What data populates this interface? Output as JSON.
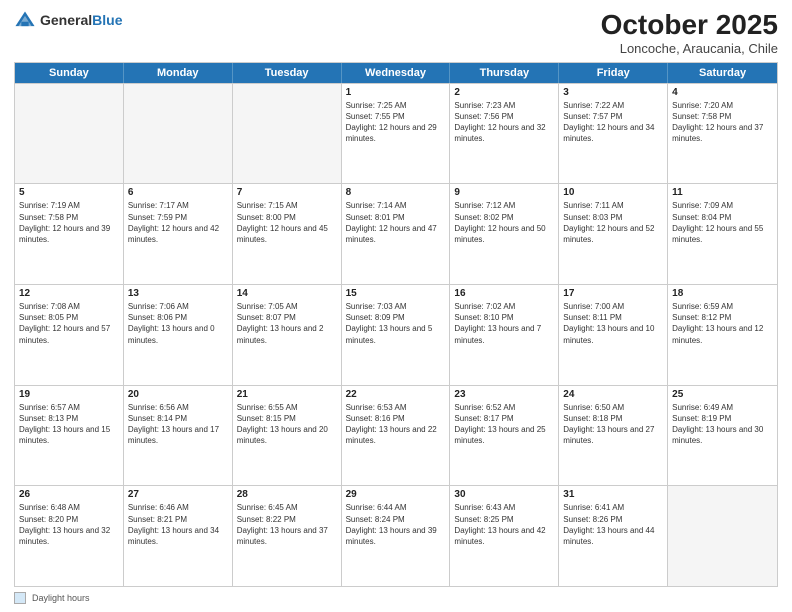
{
  "header": {
    "logo_general": "General",
    "logo_blue": "Blue",
    "month_title": "October 2025",
    "location": "Loncoche, Araucania, Chile"
  },
  "days_of_week": [
    "Sunday",
    "Monday",
    "Tuesday",
    "Wednesday",
    "Thursday",
    "Friday",
    "Saturday"
  ],
  "footer": {
    "label": "Daylight hours"
  },
  "weeks": [
    [
      {
        "day": "",
        "sunrise": "",
        "sunset": "",
        "daylight": "",
        "empty": true
      },
      {
        "day": "",
        "sunrise": "",
        "sunset": "",
        "daylight": "",
        "empty": true
      },
      {
        "day": "",
        "sunrise": "",
        "sunset": "",
        "daylight": "",
        "empty": true
      },
      {
        "day": "1",
        "sunrise": "Sunrise: 7:25 AM",
        "sunset": "Sunset: 7:55 PM",
        "daylight": "Daylight: 12 hours and 29 minutes."
      },
      {
        "day": "2",
        "sunrise": "Sunrise: 7:23 AM",
        "sunset": "Sunset: 7:56 PM",
        "daylight": "Daylight: 12 hours and 32 minutes."
      },
      {
        "day": "3",
        "sunrise": "Sunrise: 7:22 AM",
        "sunset": "Sunset: 7:57 PM",
        "daylight": "Daylight: 12 hours and 34 minutes."
      },
      {
        "day": "4",
        "sunrise": "Sunrise: 7:20 AM",
        "sunset": "Sunset: 7:58 PM",
        "daylight": "Daylight: 12 hours and 37 minutes."
      }
    ],
    [
      {
        "day": "5",
        "sunrise": "Sunrise: 7:19 AM",
        "sunset": "Sunset: 7:58 PM",
        "daylight": "Daylight: 12 hours and 39 minutes."
      },
      {
        "day": "6",
        "sunrise": "Sunrise: 7:17 AM",
        "sunset": "Sunset: 7:59 PM",
        "daylight": "Daylight: 12 hours and 42 minutes."
      },
      {
        "day": "7",
        "sunrise": "Sunrise: 7:15 AM",
        "sunset": "Sunset: 8:00 PM",
        "daylight": "Daylight: 12 hours and 45 minutes."
      },
      {
        "day": "8",
        "sunrise": "Sunrise: 7:14 AM",
        "sunset": "Sunset: 8:01 PM",
        "daylight": "Daylight: 12 hours and 47 minutes."
      },
      {
        "day": "9",
        "sunrise": "Sunrise: 7:12 AM",
        "sunset": "Sunset: 8:02 PM",
        "daylight": "Daylight: 12 hours and 50 minutes."
      },
      {
        "day": "10",
        "sunrise": "Sunrise: 7:11 AM",
        "sunset": "Sunset: 8:03 PM",
        "daylight": "Daylight: 12 hours and 52 minutes."
      },
      {
        "day": "11",
        "sunrise": "Sunrise: 7:09 AM",
        "sunset": "Sunset: 8:04 PM",
        "daylight": "Daylight: 12 hours and 55 minutes."
      }
    ],
    [
      {
        "day": "12",
        "sunrise": "Sunrise: 7:08 AM",
        "sunset": "Sunset: 8:05 PM",
        "daylight": "Daylight: 12 hours and 57 minutes."
      },
      {
        "day": "13",
        "sunrise": "Sunrise: 7:06 AM",
        "sunset": "Sunset: 8:06 PM",
        "daylight": "Daylight: 13 hours and 0 minutes."
      },
      {
        "day": "14",
        "sunrise": "Sunrise: 7:05 AM",
        "sunset": "Sunset: 8:07 PM",
        "daylight": "Daylight: 13 hours and 2 minutes."
      },
      {
        "day": "15",
        "sunrise": "Sunrise: 7:03 AM",
        "sunset": "Sunset: 8:09 PM",
        "daylight": "Daylight: 13 hours and 5 minutes."
      },
      {
        "day": "16",
        "sunrise": "Sunrise: 7:02 AM",
        "sunset": "Sunset: 8:10 PM",
        "daylight": "Daylight: 13 hours and 7 minutes."
      },
      {
        "day": "17",
        "sunrise": "Sunrise: 7:00 AM",
        "sunset": "Sunset: 8:11 PM",
        "daylight": "Daylight: 13 hours and 10 minutes."
      },
      {
        "day": "18",
        "sunrise": "Sunrise: 6:59 AM",
        "sunset": "Sunset: 8:12 PM",
        "daylight": "Daylight: 13 hours and 12 minutes."
      }
    ],
    [
      {
        "day": "19",
        "sunrise": "Sunrise: 6:57 AM",
        "sunset": "Sunset: 8:13 PM",
        "daylight": "Daylight: 13 hours and 15 minutes."
      },
      {
        "day": "20",
        "sunrise": "Sunrise: 6:56 AM",
        "sunset": "Sunset: 8:14 PM",
        "daylight": "Daylight: 13 hours and 17 minutes."
      },
      {
        "day": "21",
        "sunrise": "Sunrise: 6:55 AM",
        "sunset": "Sunset: 8:15 PM",
        "daylight": "Daylight: 13 hours and 20 minutes."
      },
      {
        "day": "22",
        "sunrise": "Sunrise: 6:53 AM",
        "sunset": "Sunset: 8:16 PM",
        "daylight": "Daylight: 13 hours and 22 minutes."
      },
      {
        "day": "23",
        "sunrise": "Sunrise: 6:52 AM",
        "sunset": "Sunset: 8:17 PM",
        "daylight": "Daylight: 13 hours and 25 minutes."
      },
      {
        "day": "24",
        "sunrise": "Sunrise: 6:50 AM",
        "sunset": "Sunset: 8:18 PM",
        "daylight": "Daylight: 13 hours and 27 minutes."
      },
      {
        "day": "25",
        "sunrise": "Sunrise: 6:49 AM",
        "sunset": "Sunset: 8:19 PM",
        "daylight": "Daylight: 13 hours and 30 minutes."
      }
    ],
    [
      {
        "day": "26",
        "sunrise": "Sunrise: 6:48 AM",
        "sunset": "Sunset: 8:20 PM",
        "daylight": "Daylight: 13 hours and 32 minutes."
      },
      {
        "day": "27",
        "sunrise": "Sunrise: 6:46 AM",
        "sunset": "Sunset: 8:21 PM",
        "daylight": "Daylight: 13 hours and 34 minutes."
      },
      {
        "day": "28",
        "sunrise": "Sunrise: 6:45 AM",
        "sunset": "Sunset: 8:22 PM",
        "daylight": "Daylight: 13 hours and 37 minutes."
      },
      {
        "day": "29",
        "sunrise": "Sunrise: 6:44 AM",
        "sunset": "Sunset: 8:24 PM",
        "daylight": "Daylight: 13 hours and 39 minutes."
      },
      {
        "day": "30",
        "sunrise": "Sunrise: 6:43 AM",
        "sunset": "Sunset: 8:25 PM",
        "daylight": "Daylight: 13 hours and 42 minutes."
      },
      {
        "day": "31",
        "sunrise": "Sunrise: 6:41 AM",
        "sunset": "Sunset: 8:26 PM",
        "daylight": "Daylight: 13 hours and 44 minutes."
      },
      {
        "day": "",
        "sunrise": "",
        "sunset": "",
        "daylight": "",
        "empty": true
      }
    ]
  ]
}
